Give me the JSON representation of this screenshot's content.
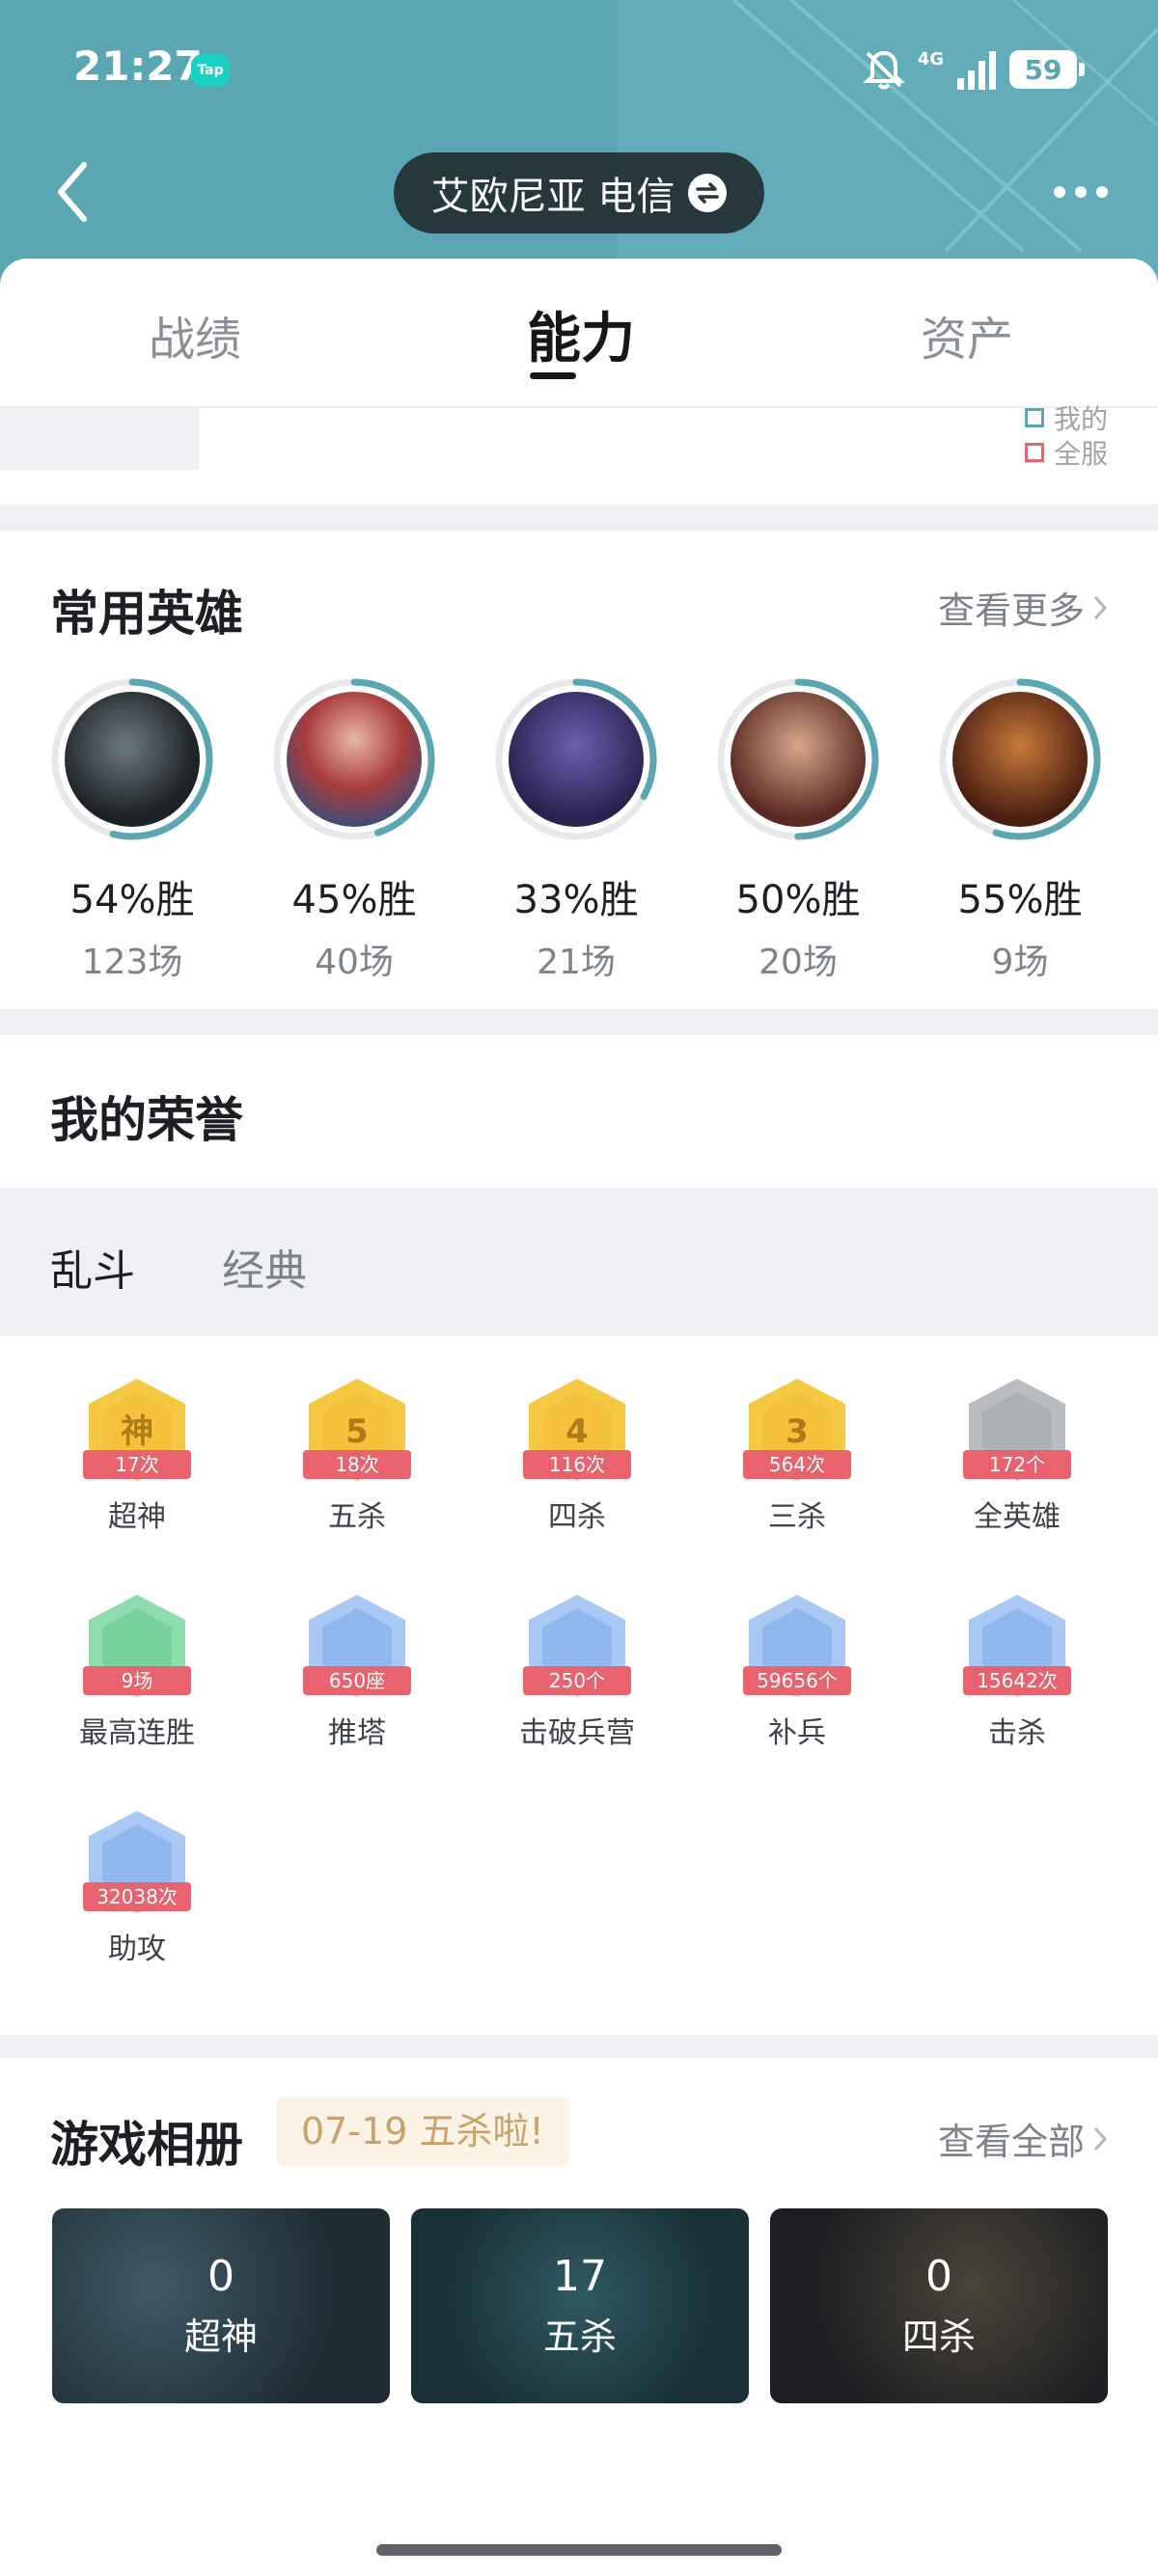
{
  "status_bar": {
    "time": "21:27",
    "app_badge": "Tap",
    "network": "4G",
    "battery": "59",
    "icons": [
      "mute-icon",
      "signal-icon",
      "battery-icon"
    ]
  },
  "nav": {
    "server": "艾欧尼亚 电信",
    "icons": [
      "back-icon",
      "switch-icon",
      "more-icon"
    ]
  },
  "tabs": [
    {
      "label": "战绩",
      "active": false
    },
    {
      "label": "能力",
      "active": true
    },
    {
      "label": "资产",
      "active": false
    }
  ],
  "chart_legend": {
    "mine": "我的",
    "all_server": "全服"
  },
  "heroes": {
    "title": "常用英雄",
    "see_more": "查看更多",
    "items": [
      {
        "rate": "54%胜",
        "games": "123场",
        "win_fraction": 0.54
      },
      {
        "rate": "45%胜",
        "games": "40场",
        "win_fraction": 0.45
      },
      {
        "rate": "33%胜",
        "games": "21场",
        "win_fraction": 0.33
      },
      {
        "rate": "50%胜",
        "games": "20场",
        "win_fraction": 0.5
      },
      {
        "rate": "55%胜",
        "games": "9场",
        "win_fraction": 0.55
      }
    ]
  },
  "honors": {
    "title": "我的荣誉",
    "modes": [
      {
        "label": "乱斗",
        "active": true
      },
      {
        "label": "经典",
        "active": false
      }
    ],
    "badges": [
      {
        "glyph": "神",
        "count": "17次",
        "label": "超神",
        "color": "gold",
        "icon": "godlike-badge-icon"
      },
      {
        "glyph": "5",
        "count": "18次",
        "label": "五杀",
        "color": "gold",
        "icon": "pentakill-badge-icon"
      },
      {
        "glyph": "4",
        "count": "116次",
        "label": "四杀",
        "color": "gold",
        "icon": "quadrakill-badge-icon"
      },
      {
        "glyph": "3",
        "count": "564次",
        "label": "三杀",
        "color": "gold",
        "icon": "triplekill-badge-icon"
      },
      {
        "glyph": "",
        "count": "172个",
        "label": "全英雄",
        "color": "gray",
        "icon": "all-heroes-badge-icon"
      },
      {
        "glyph": "",
        "count": "9场",
        "label": "最高连胜",
        "color": "green",
        "icon": "trophy-badge-icon"
      },
      {
        "glyph": "",
        "count": "650座",
        "label": "推塔",
        "color": "blue",
        "icon": "tower-badge-icon"
      },
      {
        "glyph": "",
        "count": "250个",
        "label": "击破兵营",
        "color": "blue",
        "icon": "inhibitor-badge-icon"
      },
      {
        "glyph": "",
        "count": "59656个",
        "label": "补兵",
        "color": "blue",
        "icon": "minion-badge-icon"
      },
      {
        "glyph": "",
        "count": "15642次",
        "label": "击杀",
        "color": "blue",
        "icon": "kill-badge-icon"
      },
      {
        "glyph": "",
        "count": "32038次",
        "label": "助攻",
        "color": "blue",
        "icon": "assist-badge-icon"
      }
    ]
  },
  "album": {
    "title": "游戏相册",
    "tip": "07-19 五杀啦!",
    "see_all": "查看全部",
    "items": [
      {
        "count": "0",
        "type": "超神"
      },
      {
        "count": "17",
        "type": "五杀"
      },
      {
        "count": "0",
        "type": "四杀"
      }
    ]
  },
  "colors": {
    "header": "#5aa7b3",
    "ring": "#5aa7b3",
    "ribbon": "#e9636e",
    "gold": "#f6c945",
    "blue": "#a9c8f4",
    "green": "#8fdcae",
    "gray": "#b9bcc1"
  }
}
